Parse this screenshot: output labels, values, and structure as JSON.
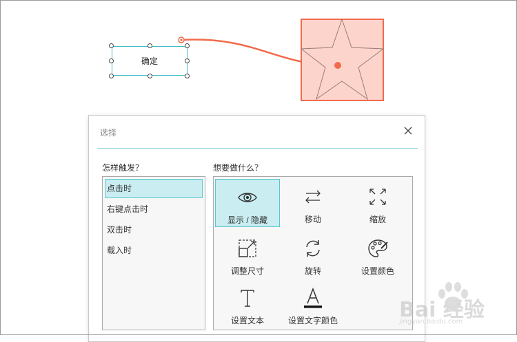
{
  "canvas": {
    "button_label": "确定",
    "colors": {
      "selection": "#3fbcc5",
      "connector": "#f26a4b",
      "shape_fill": "#fdd4cc",
      "shape_stroke": "#f26a4b",
      "star_stroke": "#9a7d78"
    }
  },
  "dialog": {
    "title": "选择",
    "close_icon": "close-icon",
    "trigger_heading": "怎样触发？",
    "action_heading": "想要做什么？",
    "triggers": [
      {
        "label": "点击时",
        "selected": true
      },
      {
        "label": "右键点击时",
        "selected": false
      },
      {
        "label": "双击时",
        "selected": false
      },
      {
        "label": "载入时",
        "selected": false
      }
    ],
    "actions": [
      {
        "label": "显示 / 隐藏",
        "icon": "eye-icon",
        "selected": true
      },
      {
        "label": "移动",
        "icon": "move-arrows-icon",
        "selected": false
      },
      {
        "label": "缩放",
        "icon": "scale-arrows-icon",
        "selected": false
      },
      {
        "label": "调整尺寸",
        "icon": "resize-icon",
        "selected": false
      },
      {
        "label": "旋转",
        "icon": "rotate-icon",
        "selected": false
      },
      {
        "label": "设置颜色",
        "icon": "palette-icon",
        "selected": false
      },
      {
        "label": "设置文本",
        "icon": "text-icon",
        "selected": false
      },
      {
        "label": "设置文字颜色",
        "icon": "text-color-icon",
        "selected": false
      }
    ],
    "colors": {
      "selected_bg": "#c9edf1",
      "selected_border": "#59c6d0",
      "divider": "#8fd6de"
    }
  },
  "watermark": {
    "brand": "Bai 经验",
    "url": "jingyan.baidu.com"
  }
}
